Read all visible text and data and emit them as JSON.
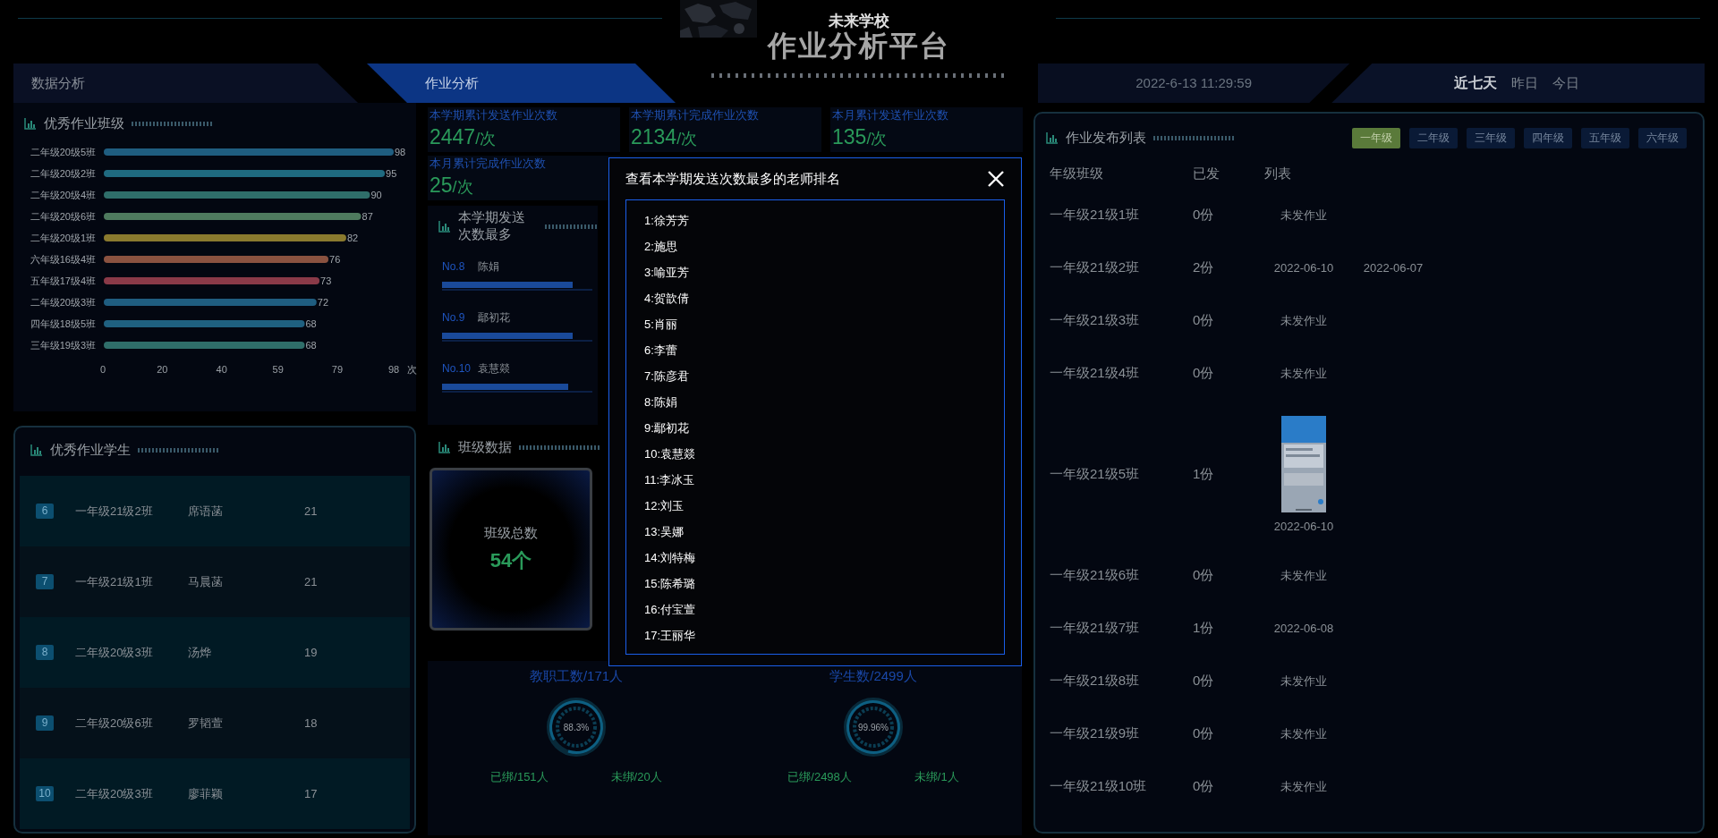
{
  "header": {
    "school": "未来学校",
    "title": "作业分析平台",
    "nav_tabs": [
      {
        "label": "数据分析",
        "selected": false
      },
      {
        "label": "作业分析",
        "selected": true
      }
    ],
    "datetime": "2022-6-13 11:29:59",
    "ranges": [
      {
        "label": "近七天",
        "selected": true
      },
      {
        "label": "昨日",
        "selected": false
      },
      {
        "label": "今日",
        "selected": false
      }
    ]
  },
  "top_classes": {
    "title": "优秀作业班级",
    "chart_data": {
      "type": "bar",
      "orientation": "horizontal",
      "categories": [
        "二年级20级5班",
        "二年级20级2班",
        "二年级20级4班",
        "二年级20级6班",
        "二年级20级1班",
        "六年级16级4班",
        "五年级17级4班",
        "二年级20级3班",
        "四年级18级5班",
        "三年级19级3班"
      ],
      "series": [
        {
          "values": [
            98,
            95,
            90,
            87,
            82,
            76,
            73,
            72,
            68,
            68
          ]
        }
      ],
      "xlim": [
        0,
        98
      ],
      "xticks": [
        0,
        20,
        40,
        59,
        79,
        98
      ],
      "xlabel": "次",
      "data_labels": true
    }
  },
  "top_students": {
    "title": "优秀作业学生",
    "rows": [
      {
        "rank": "6",
        "class": "一年级21级2班",
        "name": "席语菡",
        "count": "21"
      },
      {
        "rank": "7",
        "class": "一年级21级1班",
        "name": "马晨菡",
        "count": "21"
      },
      {
        "rank": "8",
        "class": "二年级20级3班",
        "name": "汤烨",
        "count": "19"
      },
      {
        "rank": "9",
        "class": "二年级20级6班",
        "name": "罗韬萱",
        "count": "18"
      },
      {
        "rank": "10",
        "class": "二年级20级3班",
        "name": "廖菲颖",
        "count": "17"
      }
    ]
  },
  "stats": [
    {
      "label": "本学期累计发送作业次数",
      "value": "2447",
      "unit": "/次"
    },
    {
      "label": "本学期累计完成作业次数",
      "value": "2134",
      "unit": "/次"
    },
    {
      "label": "本月累计发送作业次数",
      "value": "135",
      "unit": "/次"
    },
    {
      "label": "本月累计完成作业次数",
      "value": "25",
      "unit": "/次"
    }
  ],
  "teacher_ranking": {
    "title": "本学期发送次数最多",
    "rows": [
      {
        "rank": "No.8",
        "name": "陈娟",
        "level": 0.87
      },
      {
        "rank": "No.9",
        "name": "鄢初花",
        "level": 0.87
      },
      {
        "rank": "No.10",
        "name": "袁慧燚",
        "level": 0.84
      }
    ]
  },
  "class_data": {
    "title": "班级数据",
    "cards": [
      {
        "label": "班级总数",
        "value": "54个"
      }
    ]
  },
  "bindings": [
    {
      "title": "教职工数/171人",
      "percent": "88.3%",
      "level": 0.883,
      "bound": "已绑/151人",
      "unbound": "未绑/20人"
    },
    {
      "title": "学生数/2499人",
      "percent": "99.96%",
      "level": 0.9996,
      "bound": "已绑/2498人",
      "unbound": "未绑/1人"
    }
  ],
  "homework_list": {
    "title": "作业发布列表",
    "grades": [
      {
        "label": "一年级",
        "selected": true
      },
      {
        "label": "二年级",
        "selected": false
      },
      {
        "label": "三年级",
        "selected": false
      },
      {
        "label": "四年级",
        "selected": false
      },
      {
        "label": "五年级",
        "selected": false
      },
      {
        "label": "六年级",
        "selected": false
      }
    ],
    "columns": [
      "年级班级",
      "已发",
      "列表"
    ],
    "rows": [
      {
        "class": "一年级21级1班",
        "sent": "0份",
        "entries": [
          {
            "kind": "empty",
            "text": "未发作业"
          }
        ]
      },
      {
        "class": "一年级21级2班",
        "sent": "2份",
        "entries": [
          {
            "kind": "date",
            "text": "2022-06-10"
          },
          {
            "kind": "date",
            "text": "2022-06-07"
          }
        ]
      },
      {
        "class": "一年级21级3班",
        "sent": "0份",
        "entries": [
          {
            "kind": "empty",
            "text": "未发作业"
          }
        ]
      },
      {
        "class": "一年级21级4班",
        "sent": "0份",
        "entries": [
          {
            "kind": "empty",
            "text": "未发作业"
          }
        ]
      },
      {
        "class": "一年级21级5班",
        "sent": "1份",
        "entries": [
          {
            "kind": "thumbnail",
            "text": "2022-06-10"
          }
        ]
      },
      {
        "class": "一年级21级6班",
        "sent": "0份",
        "entries": [
          {
            "kind": "empty",
            "text": "未发作业"
          }
        ]
      },
      {
        "class": "一年级21级7班",
        "sent": "1份",
        "entries": [
          {
            "kind": "date",
            "text": "2022-06-08"
          }
        ]
      },
      {
        "class": "一年级21级8班",
        "sent": "0份",
        "entries": [
          {
            "kind": "empty",
            "text": "未发作业"
          }
        ]
      },
      {
        "class": "一年级21级9班",
        "sent": "0份",
        "entries": [
          {
            "kind": "empty",
            "text": "未发作业"
          }
        ]
      },
      {
        "class": "一年级21级10班",
        "sent": "0份",
        "entries": [
          {
            "kind": "empty",
            "text": "未发作业"
          }
        ]
      }
    ]
  },
  "modal": {
    "title": "查看本学期发送次数最多的老师排名",
    "items": [
      "1:徐芳芳",
      "2:施思",
      "3:喻亚芳",
      "4:贺歆倩",
      "5:肖丽",
      "6:李蕾",
      "7:陈彦君",
      "8:陈娟",
      "9:鄢初花",
      "10:袁慧燚",
      "11:李冰玉",
      "12:刘玉",
      "13:吴娜",
      "14:刘特梅",
      "15:陈希璐",
      "16:付宝萱",
      "17:王丽华"
    ]
  }
}
